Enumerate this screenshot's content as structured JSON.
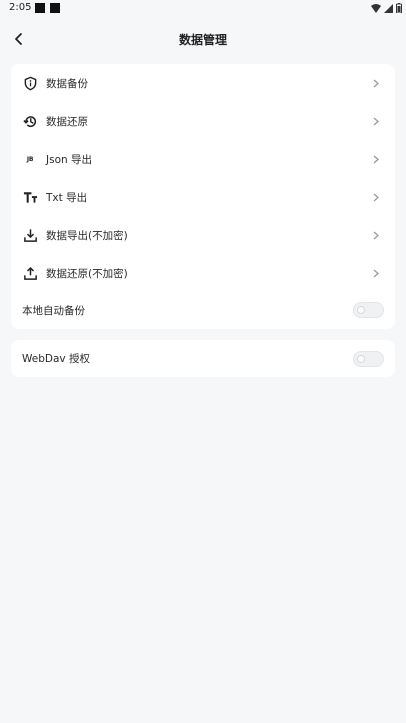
{
  "status_bar": {
    "time": "2:05"
  },
  "header": {
    "title": "数据管理"
  },
  "menu": {
    "items": [
      {
        "label": "数据备份",
        "icon": "shield-info-icon"
      },
      {
        "label": "数据还原",
        "icon": "history-icon"
      },
      {
        "label": "Json 导出",
        "icon": "json-icon",
        "icon_text": "JB"
      },
      {
        "label": "Txt 导出",
        "icon": "text-format-icon"
      },
      {
        "label": "数据导出(不加密)",
        "icon": "download-icon"
      },
      {
        "label": "数据还原(不加密)",
        "icon": "upload-icon"
      }
    ],
    "auto_backup": {
      "label": "本地自动备份",
      "enabled": false
    }
  },
  "webdav": {
    "label": "WebDav 授权",
    "enabled": false
  },
  "colors": {
    "background": "#f6f7f9",
    "card": "#ffffff",
    "text": "#2a2a2a",
    "chevron": "#9a9a9a"
  }
}
